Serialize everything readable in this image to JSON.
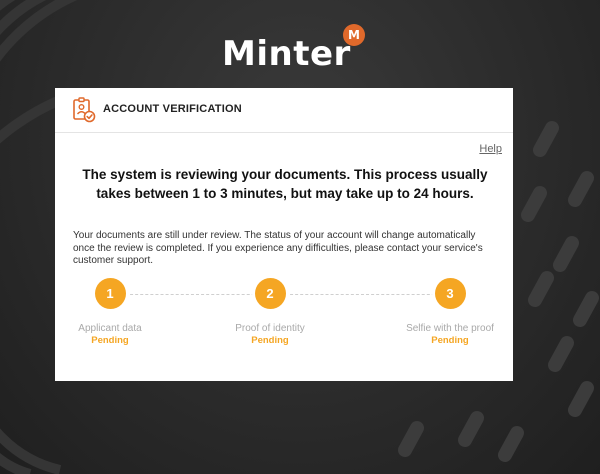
{
  "brand": {
    "name": "Minter",
    "badge": "M",
    "badge_color": "#e0692b"
  },
  "card": {
    "header_icon": "id-card-check-icon",
    "title": "ACCOUNT VERIFICATION",
    "help_label": "Help",
    "headline": "The system is reviewing your documents. This process usually takes between 1 to 3 minutes, but may take up to 24 hours.",
    "description": "Your documents are still under review. The status of your account will change automatically once the review is completed. If you experience any difficulties, please contact your service's customer support."
  },
  "steps": [
    {
      "number": "1",
      "label": "Applicant data",
      "status": "Pending"
    },
    {
      "number": "2",
      "label": "Proof of identity",
      "status": "Pending"
    },
    {
      "number": "3",
      "label": "Selfie with the proof",
      "status": "Pending"
    }
  ],
  "colors": {
    "accent": "#f5a623",
    "background": "#2b2b2b",
    "card": "#ffffff"
  }
}
